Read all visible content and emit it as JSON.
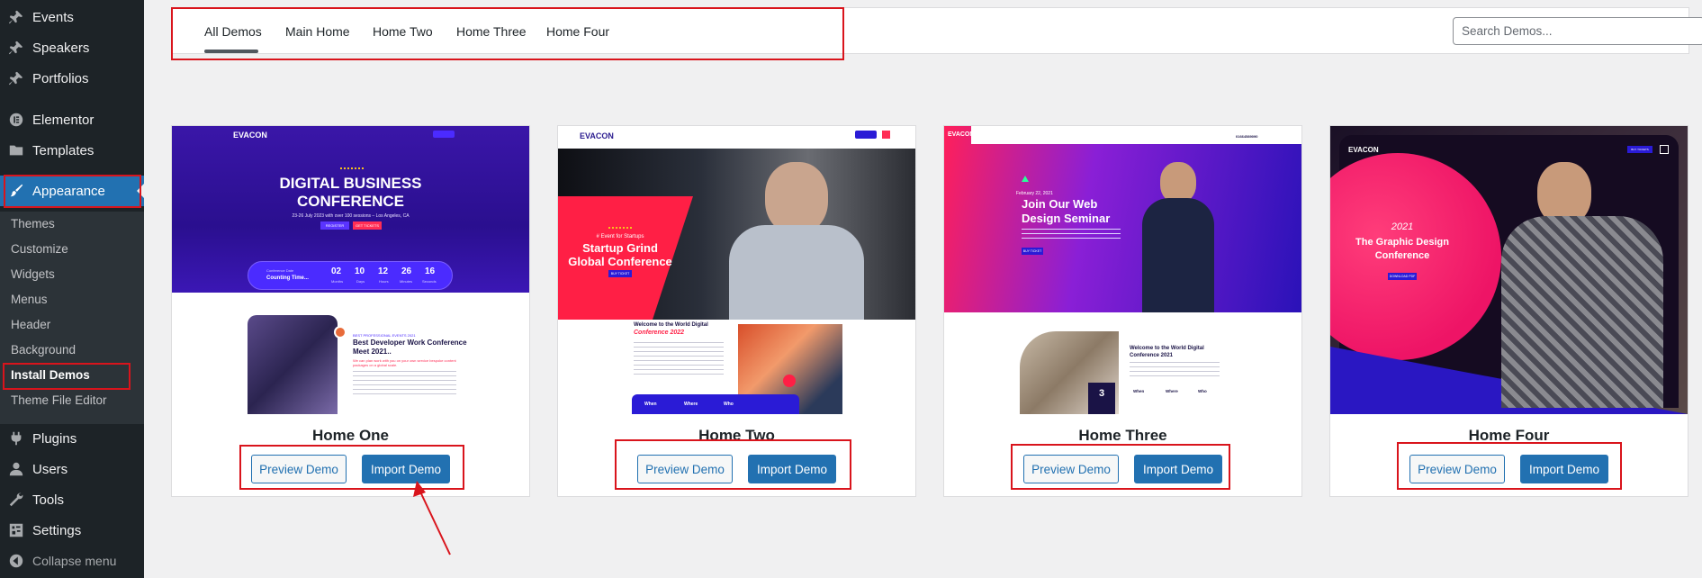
{
  "sidebar": {
    "items": [
      {
        "label": "Events",
        "icon": "pin-icon"
      },
      {
        "label": "Speakers",
        "icon": "pin-icon"
      },
      {
        "label": "Portfolios",
        "icon": "pin-icon"
      },
      {
        "label": "Elementor",
        "icon": "elementor-icon"
      },
      {
        "label": "Templates",
        "icon": "folder-icon"
      },
      {
        "label": "Appearance",
        "icon": "paintbrush-icon"
      }
    ],
    "submenu": [
      "Themes",
      "Customize",
      "Widgets",
      "Menus",
      "Header",
      "Background",
      "Install Demos",
      "Theme File Editor"
    ],
    "lower_items": [
      {
        "label": "Plugins",
        "icon": "plug-icon"
      },
      {
        "label": "Users",
        "icon": "user-icon"
      },
      {
        "label": "Tools",
        "icon": "wrench-icon"
      },
      {
        "label": "Settings",
        "icon": "settings-icon"
      }
    ],
    "collapse_label": "Collapse menu"
  },
  "filters": {
    "tabs": [
      "All Demos",
      "Main Home",
      "Home Two",
      "Home Three",
      "Home Four"
    ],
    "search_placeholder": "Search Demos..."
  },
  "demos": [
    {
      "title": "Home One",
      "preview_label": "Preview Demo",
      "import_label": "Import Demo",
      "thumb": {
        "logo": "EVACON",
        "headline1": "DIGITAL BUSINESS",
        "headline2": "CONFERENCE",
        "date_line": "23-26 July 2023 with over 100 sessions – Los Angeles, CA",
        "cta1": "REGISTER",
        "cta2": "GET TICKETS",
        "counter_title": "Conference Date",
        "counter_sub": "Counting Time...",
        "counter": [
          {
            "v": "02",
            "u": "Months"
          },
          {
            "v": "10",
            "u": "Days"
          },
          {
            "v": "12",
            "u": "Hours"
          },
          {
            "v": "26",
            "u": "Minutes"
          },
          {
            "v": "16",
            "u": "Seconds"
          }
        ],
        "kicker": "BEST PROFESSIONAL EVENTS 2021",
        "title1": "Best Developer Work Conference",
        "title2": "Meet 2021..",
        "accent": "We can plan work with you on your own service bespoke content packages on a global scale."
      }
    },
    {
      "title": "Home Two",
      "preview_label": "Preview Demo",
      "import_label": "Import Demo",
      "thumb": {
        "logo": "EVACON",
        "kicker": "# Event for Startups",
        "headline1": "Startup Grind",
        "headline2": "Global Conference",
        "cta": "BUY TICKET",
        "welcome1": "Welcome to the World Digital",
        "welcome2": "Conference 2022",
        "labels": [
          "When",
          "Where",
          "Who"
        ]
      }
    },
    {
      "title": "Home Three",
      "preview_label": "Preview Demo",
      "import_label": "Import Demo",
      "thumb": {
        "logo": "EVACON",
        "phone": "01664589090",
        "date": "February 22, 2021",
        "headline1": "Join Our Web",
        "headline2": "Design Seminar",
        "cta": "BUY TICKET",
        "welcome1": "Welcome to the World Digital",
        "welcome2": "Conference 2021",
        "badge_num": "3",
        "labels": [
          "When",
          "Where",
          "Who"
        ]
      }
    },
    {
      "title": "Home Four",
      "preview_label": "Preview Demo",
      "import_label": "Import Demo",
      "thumb": {
        "logo": "EVACON",
        "year": "2021",
        "headline1": "The Graphic Design",
        "headline2": "Conference",
        "cta": "DOWNLOAD PDF",
        "ticket": "BUY TICKETS"
      }
    }
  ],
  "colors": {
    "accent": "#2271b1",
    "sidebar_bg": "#1d2327",
    "annotation": "#d9141c"
  }
}
